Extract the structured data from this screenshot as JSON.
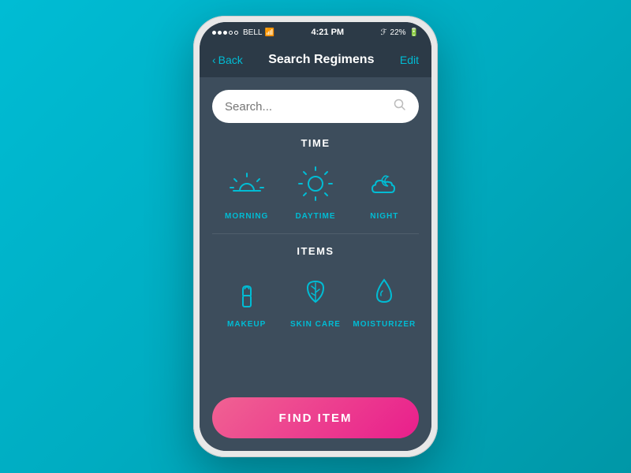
{
  "statusBar": {
    "carrier": "BELL",
    "time": "4:21 PM",
    "battery": "22%"
  },
  "navBar": {
    "backLabel": "Back",
    "title": "Search Regimens",
    "editLabel": "Edit"
  },
  "search": {
    "placeholder": "Search..."
  },
  "timeSection": {
    "label": "TIME",
    "items": [
      {
        "id": "morning",
        "label": "MORNING"
      },
      {
        "id": "daytime",
        "label": "DAYTIME"
      },
      {
        "id": "night",
        "label": "NIGHT"
      }
    ]
  },
  "itemsSection": {
    "label": "ITEMS",
    "items": [
      {
        "id": "makeup",
        "label": "MAKEUP"
      },
      {
        "id": "skincare",
        "label": "SKIN CARE"
      },
      {
        "id": "moisturizer",
        "label": "MOISTURIZER"
      }
    ]
  },
  "findButton": {
    "label": "FIND ITEM"
  }
}
